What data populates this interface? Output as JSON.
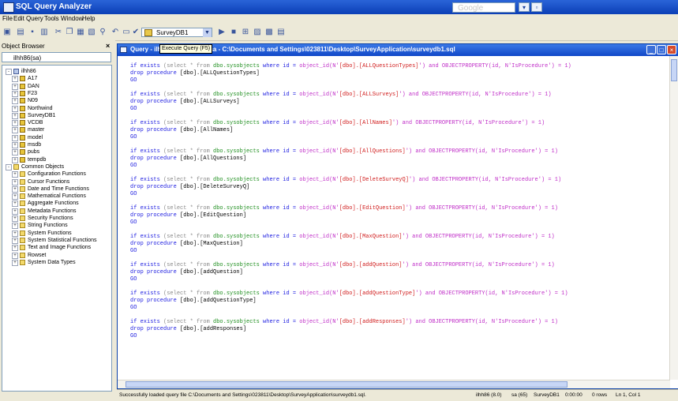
{
  "app": {
    "title": "SQL Query Analyzer"
  },
  "browser_ctrl": {
    "search_text": "Google",
    "go_label": "▾",
    "extra_label": "▫"
  },
  "menu": [
    "File",
    "Edit",
    "Query",
    "Tools",
    "Window",
    "Help"
  ],
  "toolbar": {
    "database": "SurveyDB1",
    "tooltip": "Execute Query (F5)"
  },
  "object_browser": {
    "title": "Object Browser",
    "server": "ilhh86(sa)",
    "nodes": [
      {
        "label": "ilhh86",
        "type": "server",
        "pm": "-",
        "indent": 0
      },
      {
        "label": "A17",
        "type": "db",
        "pm": "+",
        "indent": 1
      },
      {
        "label": "DAN",
        "type": "db",
        "pm": "+",
        "indent": 1
      },
      {
        "label": "F23",
        "type": "db",
        "pm": "+",
        "indent": 1
      },
      {
        "label": "N09",
        "type": "db",
        "pm": "+",
        "indent": 1
      },
      {
        "label": "Northwind",
        "type": "db",
        "pm": "+",
        "indent": 1
      },
      {
        "label": "SurveyDB1",
        "type": "db",
        "pm": "+",
        "indent": 1
      },
      {
        "label": "VCDB",
        "type": "db",
        "pm": "+",
        "indent": 1
      },
      {
        "label": "master",
        "type": "db",
        "pm": "+",
        "indent": 1
      },
      {
        "label": "model",
        "type": "db",
        "pm": "+",
        "indent": 1
      },
      {
        "label": "msdb",
        "type": "db",
        "pm": "+",
        "indent": 1
      },
      {
        "label": "pubs",
        "type": "db",
        "pm": "+",
        "indent": 1
      },
      {
        "label": "tempdb",
        "type": "db",
        "pm": "+",
        "indent": 1
      },
      {
        "label": "Common Objects",
        "type": "folder",
        "pm": "-",
        "indent": 0
      },
      {
        "label": "Configuration Functions",
        "type": "folder",
        "pm": "+",
        "indent": 1
      },
      {
        "label": "Cursor Functions",
        "type": "folder",
        "pm": "+",
        "indent": 1
      },
      {
        "label": "Date and Time Functions",
        "type": "folder",
        "pm": "+",
        "indent": 1
      },
      {
        "label": "Mathematical Functions",
        "type": "folder",
        "pm": "+",
        "indent": 1
      },
      {
        "label": "Aggregate Functions",
        "type": "folder",
        "pm": "+",
        "indent": 1
      },
      {
        "label": "Metadata Functions",
        "type": "folder",
        "pm": "+",
        "indent": 1
      },
      {
        "label": "Security Functions",
        "type": "folder",
        "pm": "+",
        "indent": 1
      },
      {
        "label": "String Functions",
        "type": "folder",
        "pm": "+",
        "indent": 1
      },
      {
        "label": "System Functions",
        "type": "folder",
        "pm": "+",
        "indent": 1
      },
      {
        "label": "System Statistical Functions",
        "type": "folder",
        "pm": "+",
        "indent": 1
      },
      {
        "label": "Text and Image Functions",
        "type": "folder",
        "pm": "+",
        "indent": 1
      },
      {
        "label": "Rowset",
        "type": "folder",
        "pm": "+",
        "indent": 1
      },
      {
        "label": "System Data Types",
        "type": "folder",
        "pm": "+",
        "indent": 1
      }
    ]
  },
  "query_window": {
    "title": "Query - ilhh86.SurveyDB1.sa - C:\\Documents and Settings\\023811\\Desktop\\SurveyApplication\\surveydb1.sql",
    "blocks": [
      {
        "name": "ALLQuestionTypes"
      },
      {
        "name": "ALLSurveys"
      },
      {
        "name": "AllNames"
      },
      {
        "name": "AllQuestions"
      },
      {
        "name": "DeleteSurveyQ"
      },
      {
        "name": "EditQuestion"
      },
      {
        "name": "MaxQuestion"
      },
      {
        "name": "addQuestion"
      },
      {
        "name": "addQuestionType"
      },
      {
        "name": "addResponses"
      }
    ]
  },
  "code_tokens": {
    "if_exists": "if exists",
    "select": "(select * from",
    "sysobjects": "dbo.sysobjects",
    "where_id": "where id =",
    "object_id": "object_id(N'",
    "objprop": "and OBJECTPROPERTY(id, N'IsProcedure') = 1)",
    "drop": "drop procedure",
    "go": "GO"
  },
  "status": {
    "message": "Successfully loaded query file C:\\Documents and Settings\\023811\\Desktop\\SurveyApplication\\surveydb1.sql.",
    "server_info": "ilhh86 (8.0)",
    "user": "sa (65)",
    "db": "SurveyDB1",
    "time": "0:00:00",
    "rows": "0 rows",
    "position": "Ln 1, Col 1"
  }
}
